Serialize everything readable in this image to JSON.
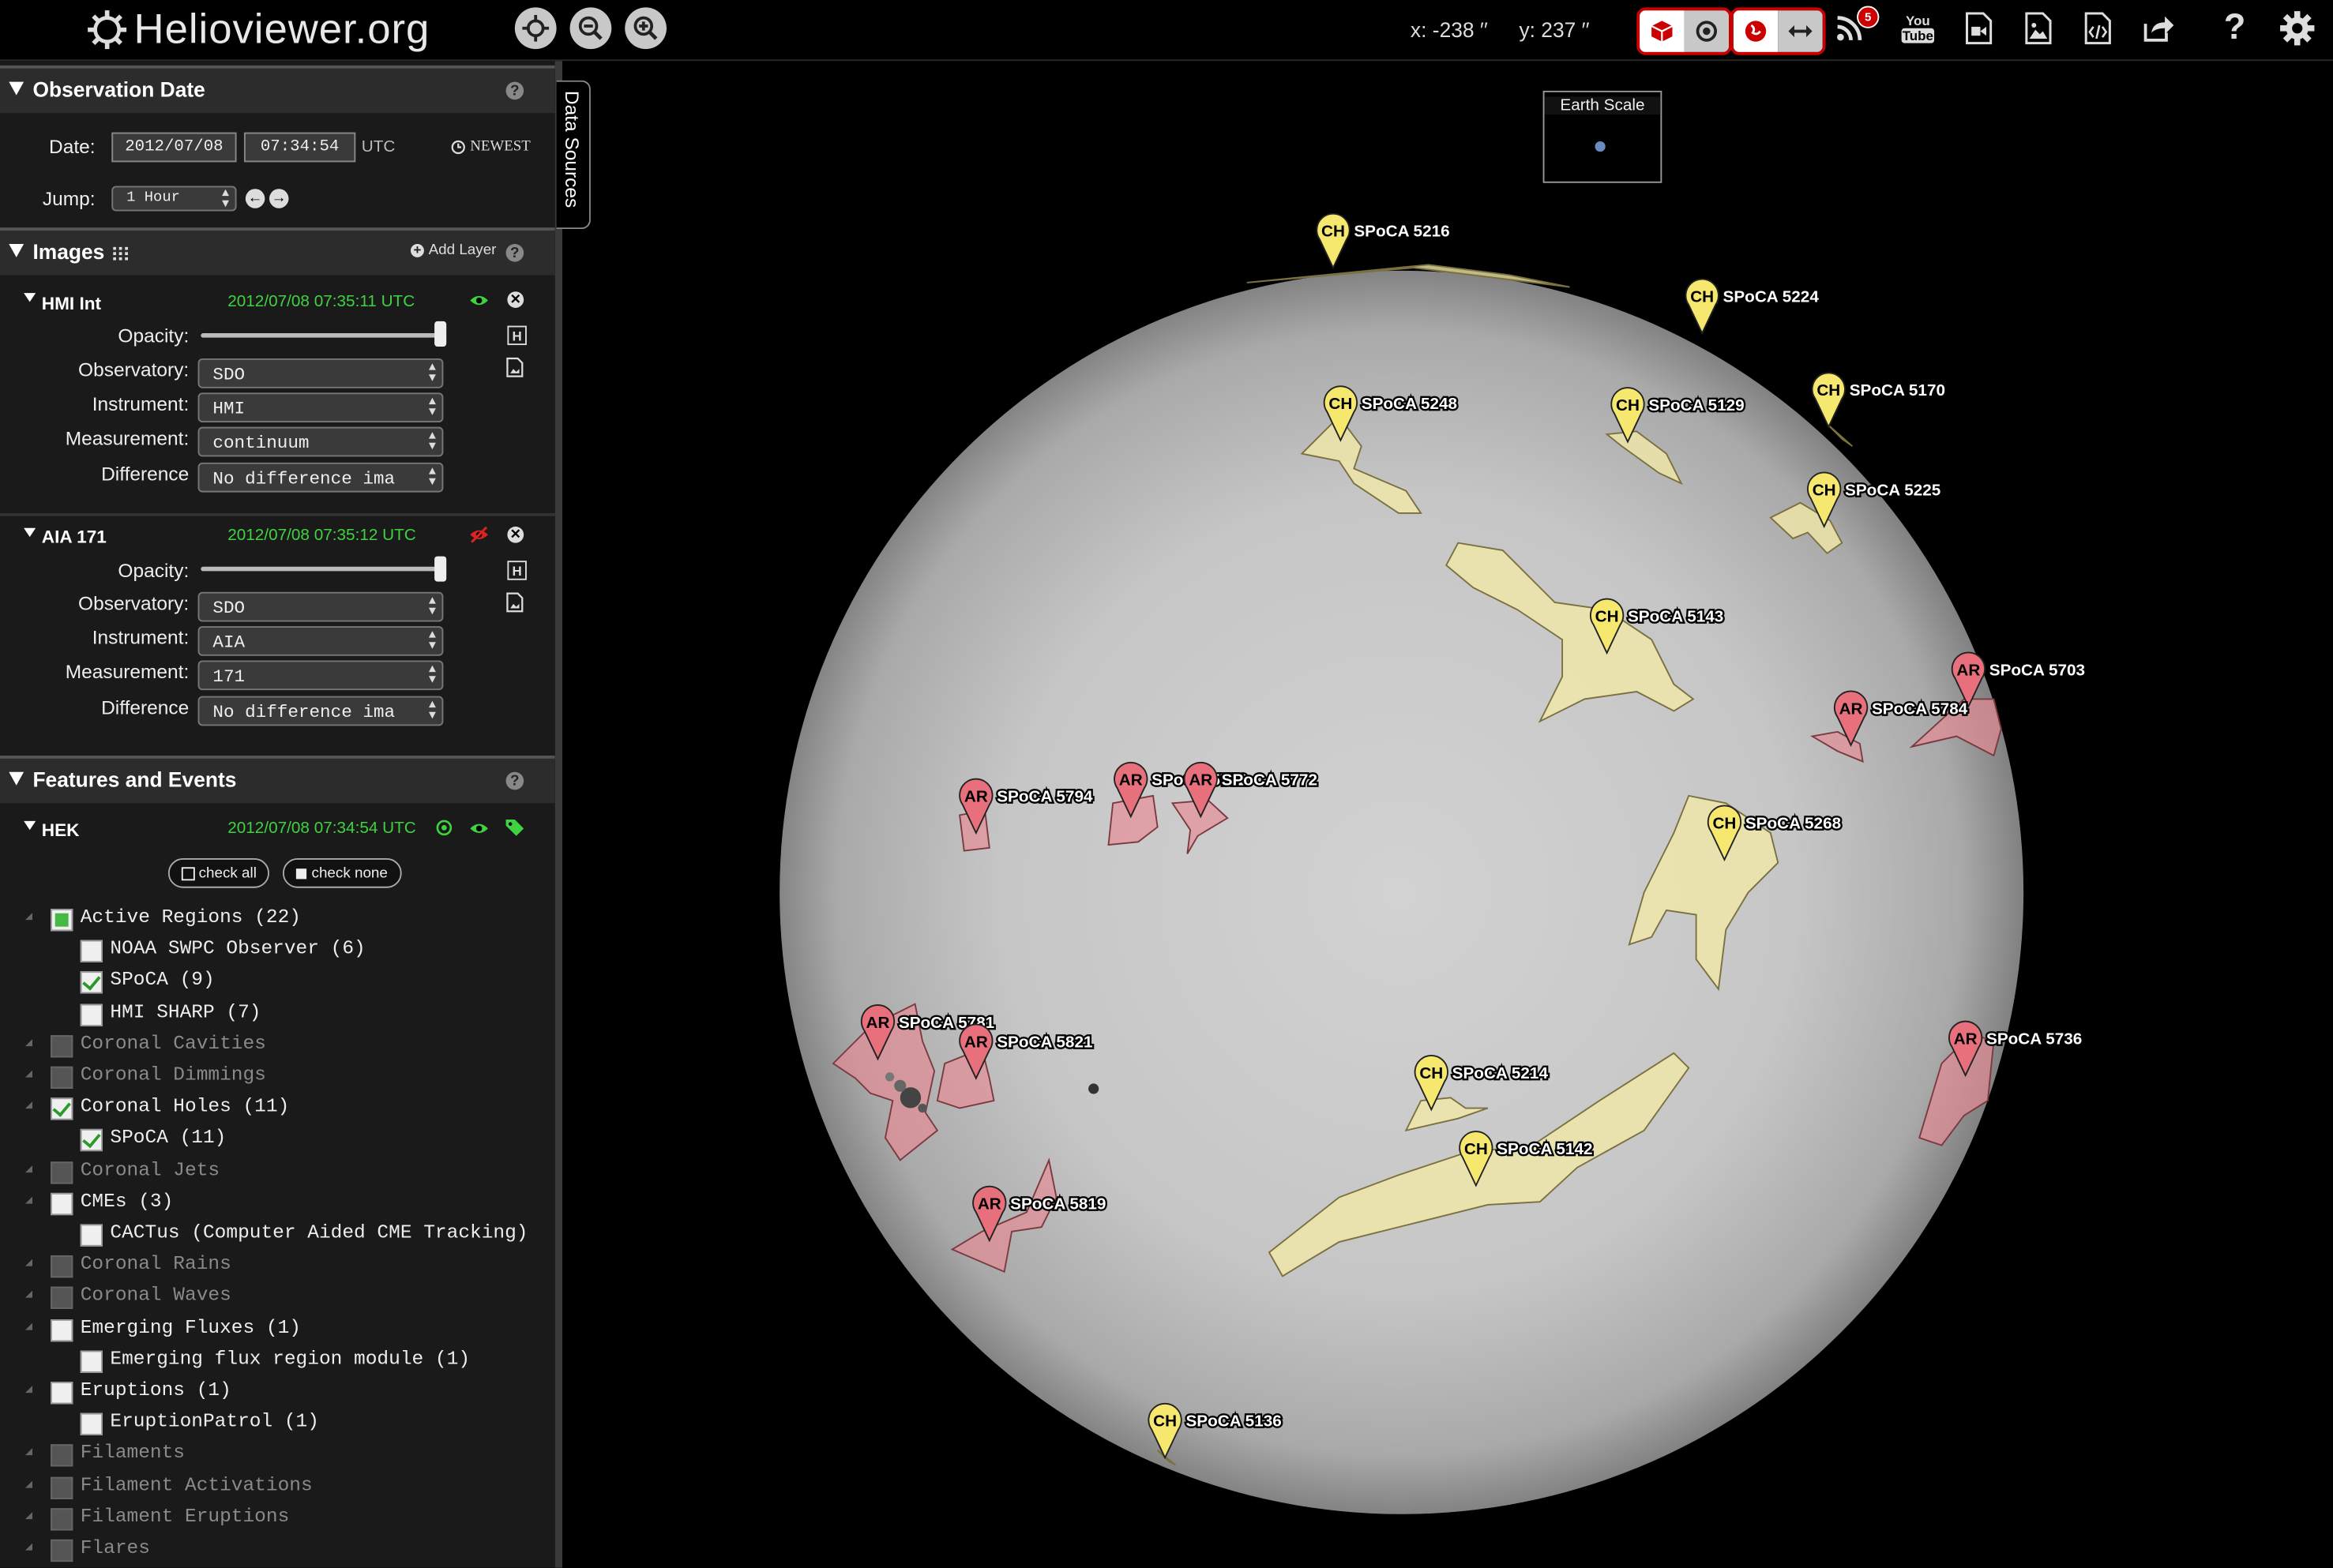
{
  "header": {
    "logo_text": "Helioviewer.org",
    "coord_x": "x: -238 ′′",
    "coord_y": "y: 237 ′′",
    "rss_badge": "5",
    "youtube_label_1": "You",
    "youtube_label_2": "Tube",
    "help_label": "?"
  },
  "observation": {
    "title": "Observation Date",
    "date_label": "Date:",
    "date_value": "2012/07/08",
    "time_value": "07:34:54",
    "utc_label": "UTC",
    "newest_label": "NEWEST",
    "jump_label": "Jump:",
    "jump_value": "1 Hour"
  },
  "images": {
    "title": "Images",
    "add_layer": "Add Layer",
    "layers": [
      {
        "name": "HMI Int",
        "timestamp": "2012/07/08 07:35:11 UTC",
        "visible": true,
        "opacity_label": "Opacity:",
        "opacity": 1.0,
        "observatory_label": "Observatory:",
        "observatory": "SDO",
        "instrument_label": "Instrument:",
        "instrument": "HMI",
        "measurement_label": "Measurement:",
        "measurement": "continuum",
        "difference_label": "Difference",
        "difference": "No difference ima"
      },
      {
        "name": "AIA 171",
        "timestamp": "2012/07/08 07:35:12 UTC",
        "visible": false,
        "opacity_label": "Opacity:",
        "opacity": 1.0,
        "observatory_label": "Observatory:",
        "observatory": "SDO",
        "instrument_label": "Instrument:",
        "instrument": "AIA",
        "measurement_label": "Measurement:",
        "measurement": "171",
        "difference_label": "Difference",
        "difference": "No difference ima"
      }
    ]
  },
  "features": {
    "title": "Features and Events",
    "hek_name": "HEK",
    "hek_timestamp": "2012/07/08 07:34:54 UTC",
    "check_all": "check all",
    "check_none": "check none",
    "tree": [
      {
        "label": "Active Regions (22)",
        "level": 0,
        "state": "partial",
        "dim": false
      },
      {
        "label": "NOAA SWPC Observer (6)",
        "level": 1,
        "state": "off",
        "dim": false
      },
      {
        "label": "SPoCA (9)",
        "level": 1,
        "state": "checked",
        "dim": false
      },
      {
        "label": "HMI SHARP (7)",
        "level": 1,
        "state": "off",
        "dim": false
      },
      {
        "label": "Coronal Cavities",
        "level": 0,
        "state": "off",
        "dim": true
      },
      {
        "label": "Coronal Dimmings",
        "level": 0,
        "state": "off",
        "dim": true
      },
      {
        "label": "Coronal Holes (11)",
        "level": 0,
        "state": "checked",
        "dim": false
      },
      {
        "label": "SPoCA (11)",
        "level": 1,
        "state": "checked",
        "dim": false
      },
      {
        "label": "Coronal Jets",
        "level": 0,
        "state": "off",
        "dim": true
      },
      {
        "label": "CMEs (3)",
        "level": 0,
        "state": "off",
        "dim": false
      },
      {
        "label": "CACTus (Computer Aided CME Tracking)",
        "level": 1,
        "state": "off",
        "dim": false
      },
      {
        "label": "Coronal Rains",
        "level": 0,
        "state": "off",
        "dim": true
      },
      {
        "label": "Coronal Waves",
        "level": 0,
        "state": "off",
        "dim": true
      },
      {
        "label": "Emerging Fluxes (1)",
        "level": 0,
        "state": "off",
        "dim": false
      },
      {
        "label": "Emerging flux region module (1)",
        "level": 1,
        "state": "off",
        "dim": false
      },
      {
        "label": "Eruptions (1)",
        "level": 0,
        "state": "off",
        "dim": false
      },
      {
        "label": "EruptionPatrol (1)",
        "level": 1,
        "state": "off",
        "dim": false
      },
      {
        "label": "Filaments",
        "level": 0,
        "state": "off",
        "dim": true
      },
      {
        "label": "Filament Activations",
        "level": 0,
        "state": "off",
        "dim": true
      },
      {
        "label": "Filament Eruptions",
        "level": 0,
        "state": "off",
        "dim": true
      },
      {
        "label": "Flares",
        "level": 0,
        "state": "off",
        "dim": true
      }
    ]
  },
  "viewport": {
    "data_sources_tab": "Data Sources",
    "earth_scale_label": "Earth Scale",
    "markers": [
      {
        "type": "CH",
        "label": "SPoCA 5216"
      },
      {
        "type": "CH",
        "label": "SPoCA 5224"
      },
      {
        "type": "CH",
        "label": "SPoCA 5248"
      },
      {
        "type": "CH",
        "label": "SPoCA 5129"
      },
      {
        "type": "CH",
        "label": "SPoCA 5170"
      },
      {
        "type": "CH",
        "label": "SPoCA 5225"
      },
      {
        "type": "CH",
        "label": "SPoCA 5143"
      },
      {
        "type": "AR",
        "label": "SPoCA 5703"
      },
      {
        "type": "AR",
        "label": "SPoCA 5784"
      },
      {
        "type": "AR",
        "label": "SPoCA 5794"
      },
      {
        "type": "AR",
        "label": "SPoCA 5772"
      },
      {
        "type": "AR",
        "label": "SPoCA 5772"
      },
      {
        "type": "CH",
        "label": "SPoCA 5268"
      },
      {
        "type": "AR",
        "label": "SPoCA 5781"
      },
      {
        "type": "AR",
        "label": "SPoCA 5821"
      },
      {
        "type": "AR",
        "label": "SPoCA 5736"
      },
      {
        "type": "CH",
        "label": "SPoCA 5214"
      },
      {
        "type": "CH",
        "label": "SPoCA 5142"
      },
      {
        "type": "AR",
        "label": "SPoCA 5819"
      },
      {
        "type": "CH",
        "label": "SPoCA 5136"
      }
    ]
  },
  "colors": {
    "ch_fill": "#f3e9a8",
    "ch_pin": "#f6e86e",
    "ar_fill": "#e88a93",
    "ar_pin": "#e8707c",
    "timestamp_green": "#3fd33f",
    "accent_red": "#cc0000"
  }
}
